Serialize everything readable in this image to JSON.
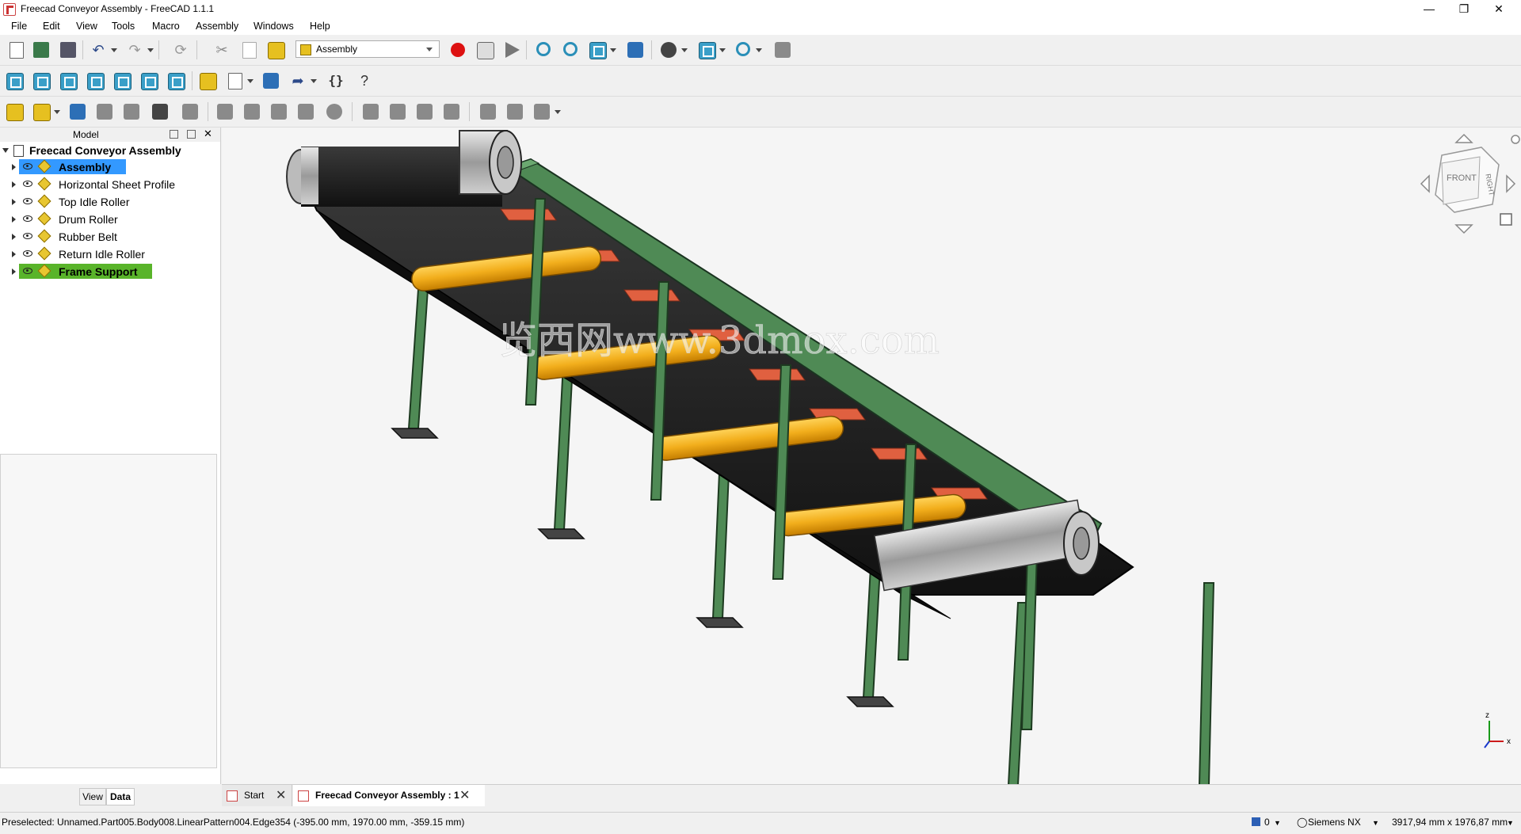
{
  "window": {
    "title": "Freecad Conveyor Assembly - FreeCAD 1.1.1"
  },
  "menu": [
    "File",
    "Edit",
    "View",
    "Tools",
    "Macro",
    "Assembly",
    "Windows",
    "Help"
  ],
  "toolbar": {
    "workbench": "Assembly"
  },
  "model_panel": {
    "title": "Model",
    "root": "Freecad Conveyor Assembly",
    "items": [
      {
        "label": "Assembly"
      },
      {
        "label": "Horizontal Sheet Profile"
      },
      {
        "label": "Top Idle Roller"
      },
      {
        "label": "Drum Roller"
      },
      {
        "label": "Rubber Belt"
      },
      {
        "label": "Return Idle Roller"
      },
      {
        "label": "Frame Support"
      }
    ],
    "tabs": [
      "View",
      "Data"
    ]
  },
  "viewport": {
    "watermark": "览西网www.3dmox.com",
    "navcube": {
      "front": "FRONT",
      "right": "RIGHT"
    },
    "axes": {
      "x": "x",
      "z": "z"
    }
  },
  "doc_tabs": [
    {
      "label": "Start"
    },
    {
      "label": "Freecad Conveyor Assembly : 1"
    }
  ],
  "status": {
    "text": "Preselected: Unnamed.Part005.Body008.LinearPattern004.Edge354 (-395.00 mm, 1970.00 mm, -359.15 mm)",
    "count": "0",
    "nav_style": "Siemens NX",
    "dimensions": "3917,94 mm x 1976,87 mm"
  },
  "colors": {
    "selected_blue": "#3399ff",
    "selected_green": "#59b42a",
    "frame_green": "#4f8a55",
    "roller_yellow": "#f2ae1c",
    "belt_black": "#141414",
    "copper": "#e06040"
  }
}
